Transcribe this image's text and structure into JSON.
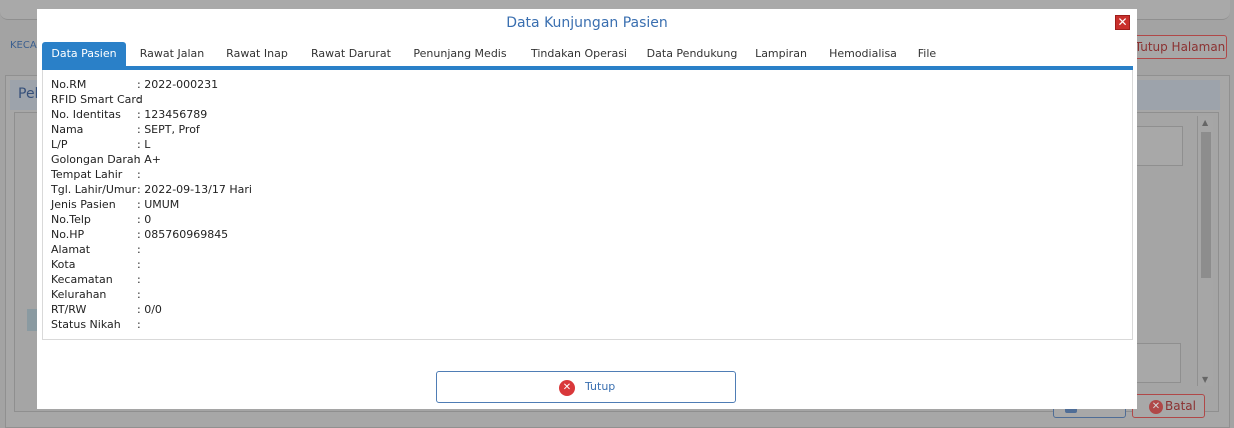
{
  "background": {
    "kec_label": "KECA",
    "pel_label": "Pel",
    "tutup_halaman": "Tutup Halaman",
    "batal": "Batal"
  },
  "modal": {
    "title": "Data Kunjungan Pasien",
    "close_icon": "close-icon",
    "tabs": [
      {
        "label": "Data Pasien",
        "active": true
      },
      {
        "label": "Rawat Jalan"
      },
      {
        "label": "Rawat Inap"
      },
      {
        "label": "Rawat Darurat"
      },
      {
        "label": "Penunjang Medis"
      },
      {
        "label": "Tindakan Operasi"
      },
      {
        "label": "Data Pendukung"
      },
      {
        "label": "Lampiran"
      },
      {
        "label": "Hemodialisa"
      },
      {
        "label": "File"
      }
    ],
    "fields": [
      {
        "label": "No.RM",
        "value": ": 2022-000231"
      },
      {
        "label": "RFID Smart Card",
        "value": ":"
      },
      {
        "label": "No. Identitas",
        "value": ": 123456789"
      },
      {
        "label": "Nama",
        "value": ": SEPT, Prof"
      },
      {
        "label": "L/P",
        "value": ": L"
      },
      {
        "label": "Golongan Darah",
        "value": ": A+"
      },
      {
        "label": "Tempat Lahir",
        "value": ":"
      },
      {
        "label": "Tgl. Lahir/Umur",
        "value": ": 2022-09-13/17 Hari"
      },
      {
        "label": "Jenis Pasien",
        "value": ": UMUM"
      },
      {
        "label": "No.Telp",
        "value": ": 0"
      },
      {
        "label": "No.HP",
        "value": ": 085760969845"
      },
      {
        "label": "Alamat",
        "value": ":"
      },
      {
        "label": "Kota",
        "value": ":"
      },
      {
        "label": "Kecamatan",
        "value": ":"
      },
      {
        "label": "Kelurahan",
        "value": ":"
      },
      {
        "label": "RT/RW",
        "value": ": 0/0"
      },
      {
        "label": "Status Nikah",
        "value": ":"
      }
    ],
    "tutup_button": "Tutup",
    "tutup_icon": "x-circle-icon"
  },
  "colors": {
    "accent": "#2a80c8",
    "title": "#3a6fb0",
    "danger": "#d9383a"
  }
}
